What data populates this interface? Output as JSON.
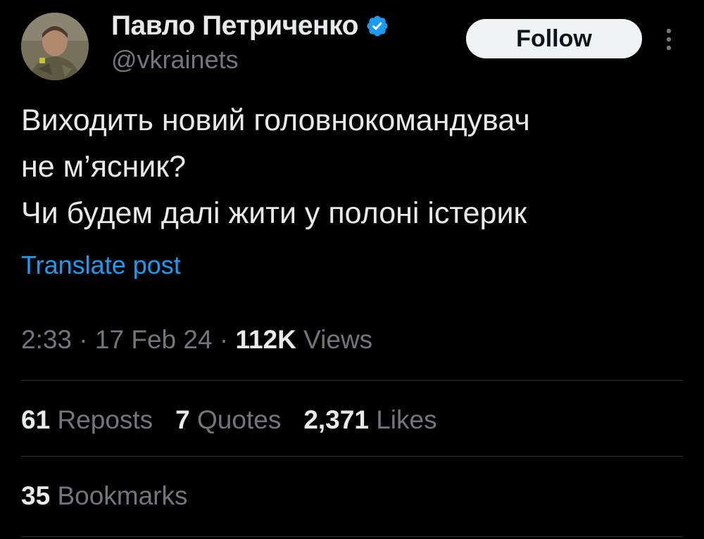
{
  "author": {
    "display_name": "Павло Петриченко",
    "handle": "@vkrainets",
    "verified": true
  },
  "follow_button": {
    "label": "Follow"
  },
  "post": {
    "text": "Виходить новий головнокомандувач\nне м’ясник?\nЧи будем далі жити у полоні істерик",
    "translate_label": "Translate post"
  },
  "meta": {
    "time": "2:33",
    "date": "17 Feb 24",
    "views_count": "112K",
    "views_label": "Views",
    "separator": "·"
  },
  "stats": {
    "reposts_count": "61",
    "reposts_label": "Reposts",
    "quotes_count": "7",
    "quotes_label": "Quotes",
    "likes_count": "2,371",
    "likes_label": "Likes",
    "bookmarks_count": "35",
    "bookmarks_label": "Bookmarks"
  },
  "colors": {
    "background": "#000000",
    "text_primary": "#e7e9ea",
    "text_secondary": "#71767b",
    "link": "#1d9bf0",
    "verified_badge": "#1d9bf0",
    "divider": "#2f3336",
    "follow_button_bg": "#eff3f4"
  },
  "icons": {
    "verified": "verified-badge-icon",
    "more": "more-vertical-icon"
  }
}
